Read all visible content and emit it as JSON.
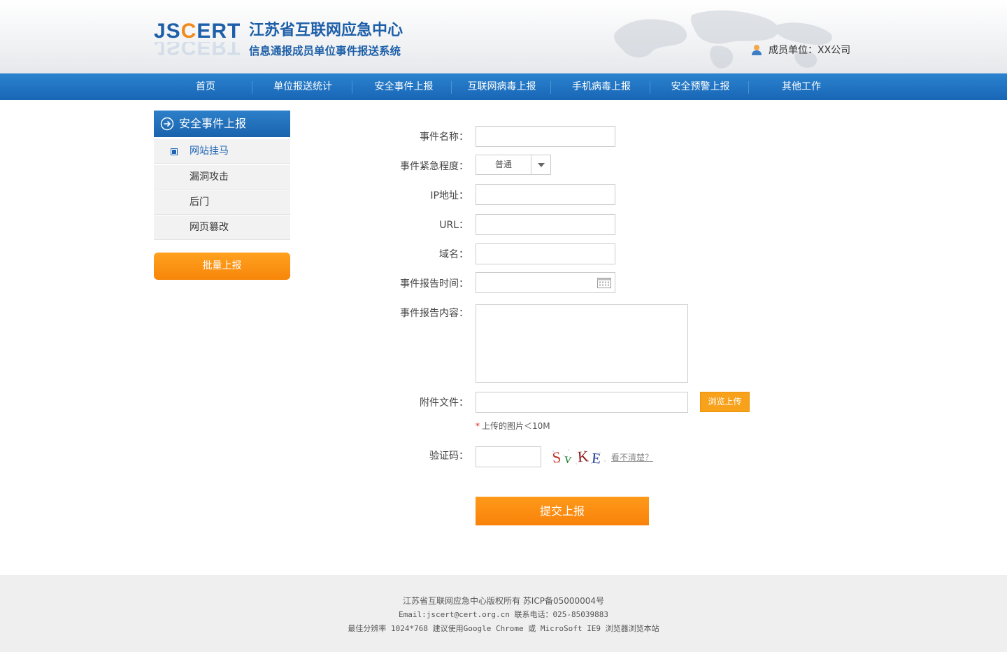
{
  "header": {
    "logo_text_prefix": "JS",
    "logo_text_o": "C",
    "logo_text_suffix": "ERT",
    "logo_title": "江苏省互联网应急中心",
    "logo_subtitle": "信息通报成员单位事件报送系统",
    "member_label": "成员单位：XX公司"
  },
  "nav": {
    "items": [
      "首页",
      "单位报送统计",
      "安全事件上报",
      "互联网病毒上报",
      "手机病毒上报",
      "安全预警上报",
      "其他工作"
    ]
  },
  "sidebar": {
    "title": "安全事件上报",
    "items": [
      {
        "label": "网站挂马",
        "active": true
      },
      {
        "label": "漏洞攻击",
        "active": false
      },
      {
        "label": "后门",
        "active": false
      },
      {
        "label": "网页篡改",
        "active": false
      }
    ],
    "batch_button": "批量上报"
  },
  "form": {
    "event_name_label": "事件名称：",
    "event_name_value": "",
    "urgency_label": "事件紧急程度：",
    "urgency_selected": "普通",
    "ip_label": "IP地址：",
    "ip_value": "",
    "url_label": "URL：",
    "url_value": "",
    "domain_label": "域名：",
    "domain_value": "",
    "report_time_label": "事件报告时间：",
    "report_time_value": "",
    "report_content_label": "事件报告内容：",
    "report_content_value": "",
    "attachment_label": "附件文件：",
    "attachment_value": "",
    "browse_button": "浏览上传",
    "upload_hint_star": "*",
    "upload_hint": "上传的图片＜10M",
    "captcha_label": "验证码：",
    "captcha_value": "",
    "captcha_text": "SvKE",
    "captcha_refresh": "看不清楚？",
    "submit_button": "提交上报"
  },
  "footer": {
    "line1": "江苏省互联网应急中心版权所有   苏ICP备05000004号",
    "line2": "Email:jscert@cert.org.cn   联系电话：025-85039883",
    "line3": "最佳分辨率 1024*768    建议使用Google Chrome 或 MicroSoft IE9 浏览器浏览本站"
  },
  "colors": {
    "brand_blue": "#1d5fa8",
    "nav_blue": "#1f72c0",
    "accent_orange": "#f9890d",
    "browse_orange": "#f8a11b"
  }
}
